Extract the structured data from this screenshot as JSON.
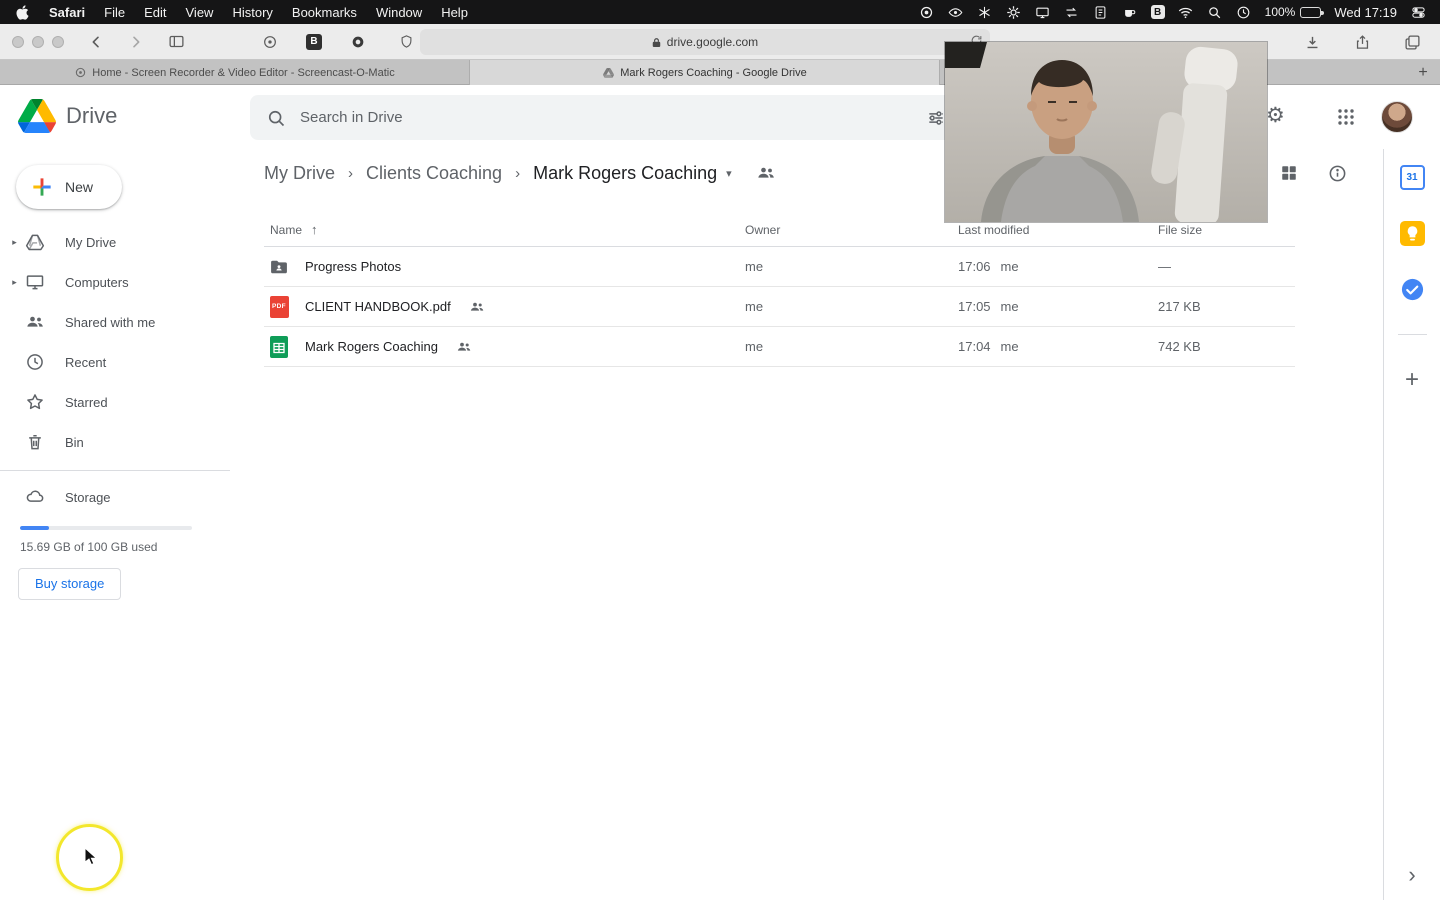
{
  "menubar": {
    "menus": [
      "Safari",
      "File",
      "Edit",
      "View",
      "History",
      "Bookmarks",
      "Window",
      "Help"
    ],
    "battery": "100%",
    "clock": "Wed 17:19"
  },
  "browser": {
    "url": "drive.google.com",
    "tabs": [
      {
        "title": "Home - Screen Recorder & Video Editor - Screencast-O-Matic"
      },
      {
        "title": "Mark Rogers Coaching - Google Drive"
      }
    ]
  },
  "drive": {
    "app_name": "Drive",
    "search": {
      "placeholder": "Search in Drive"
    },
    "breadcrumb": {
      "root": "My Drive",
      "parent": "Clients Coaching",
      "current": "Mark Rogers Coaching"
    },
    "table": {
      "headers": {
        "name": "Name",
        "owner": "Owner",
        "modified": "Last modified",
        "size": "File size"
      },
      "rows": [
        {
          "name": "Progress Photos",
          "owner": "me",
          "modified": "17:06",
          "modified_by": "me",
          "size": "—"
        },
        {
          "name": "CLIENT HANDBOOK.pdf",
          "owner": "me",
          "modified": "17:05",
          "modified_by": "me",
          "size": "217 KB"
        },
        {
          "name": "Mark Rogers Coaching",
          "owner": "me",
          "modified": "17:04",
          "modified_by": "me",
          "size": "742 KB"
        }
      ]
    },
    "sidebar": {
      "new_label": "New",
      "items": [
        "My Drive",
        "Computers",
        "Shared with me",
        "Recent",
        "Starred",
        "Bin"
      ],
      "storage": {
        "label": "Storage",
        "used": "15.69 GB of 100 GB used",
        "buy": "Buy storage",
        "percent": 17
      }
    },
    "rightbar": {
      "calendar_day": "31"
    }
  },
  "icons": {
    "pdf": "PDF",
    "bitwarden": "B"
  }
}
